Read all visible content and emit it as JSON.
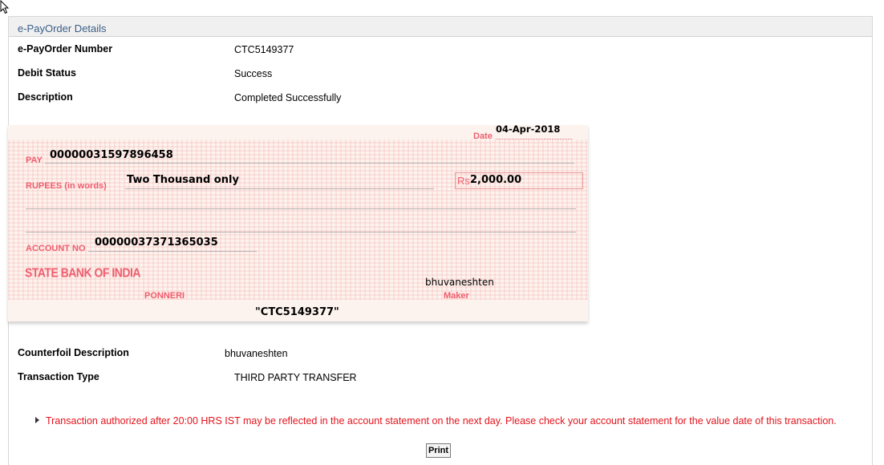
{
  "panel": {
    "title": "e-PayOrder Details"
  },
  "details": [
    {
      "label": "e-PayOrder Number",
      "value": "CTC5149377"
    },
    {
      "label": "Debit Status",
      "value": "Success"
    },
    {
      "label": "Description",
      "value": "Completed Successfully"
    }
  ],
  "cheque": {
    "date_label": "Date",
    "date": "04-Apr-2018",
    "pay_label": "PAY",
    "pay_value": "00000031597896458",
    "rupees_label": "RUPEES (in words)",
    "rupees_value": "Two Thousand only",
    "currency_symbol": "Rs",
    "amount": "2,000.00",
    "account_label": "ACCOUNT NO",
    "account_value": "00000037371365035",
    "bank_name": "STATE BANK OF INDIA",
    "branch": "PONNERI",
    "maker_name": "bhuvaneshten",
    "maker_label": "Maker",
    "reference": "\"CTC5149377\""
  },
  "details2": [
    {
      "label": "Counterfoil Description",
      "value": "bhuvaneshten"
    },
    {
      "label": "Transaction Type",
      "value": "THIRD PARTY TRANSFER"
    }
  ],
  "note": "Transaction authorized after 20:00 HRS IST may be reflected in the account statement on the next day. Please check your account statement for the value date of this transaction.",
  "print_label": "Print",
  "colors": {
    "accent": "#3b5f86",
    "cheque_red": "#ef5e6e",
    "note_red": "#e3131c"
  }
}
